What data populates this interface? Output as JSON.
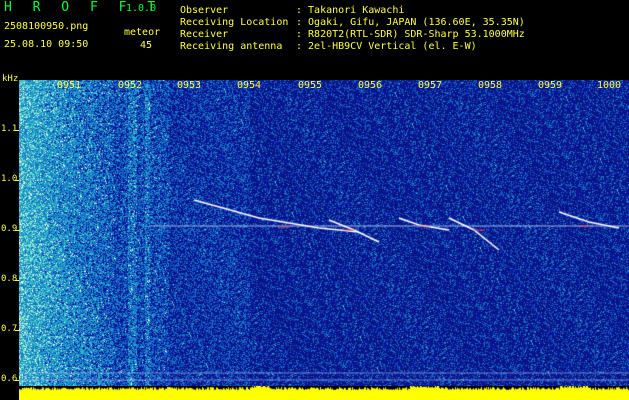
{
  "header": {
    "app_name": "H R O F F T",
    "version": "1.0.0",
    "filename": "2508100950.png",
    "datetime": "25.08.10 09:50",
    "event_type": "meteor",
    "event_count": "45",
    "fields": [
      {
        "label": "Observer",
        "value": ": Takanori Kawachi"
      },
      {
        "label": "Receiving Location",
        "value": ": Ogaki, Gifu, JAPAN (136.60E, 35.35N)"
      },
      {
        "label": "Receiver",
        "value": ": R820T2(RTL-SDR) SDR-Sharp 53.1000MHz"
      },
      {
        "label": "Receiving antenna",
        "value": ": 2el-HB9CV Vertical (el. E-W)"
      }
    ]
  },
  "axis": {
    "unit": "kHz",
    "y_ticks": [
      "1.1",
      "1.0",
      "0.9",
      "0.8",
      "0.7",
      "0.6"
    ],
    "x_ticks": [
      "0951",
      "0952",
      "0953",
      "0954",
      "0955",
      "0956",
      "0957",
      "0958",
      "0959",
      "1000"
    ]
  },
  "colors": {
    "text": "#ffff40",
    "logo": "#00ff40",
    "background": "#000000",
    "waterfall_base": "#0a1a8a",
    "signal_trace": "#ffffff",
    "power_bar": "#ffff00"
  }
}
